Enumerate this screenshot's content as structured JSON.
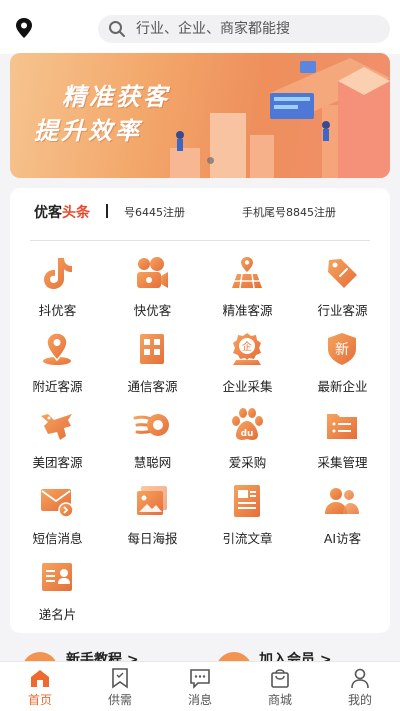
{
  "colors": {
    "accent": "#ee6a2f",
    "icon_gradient_start": "#f5a45e",
    "icon_gradient_end": "#e56e3a",
    "headline_highlight": "#e9492c"
  },
  "search": {
    "placeholder": "行业、企业、商家都能搜",
    "icon": "search-icon"
  },
  "location": {
    "icon": "location-pin-icon"
  },
  "banner": {
    "line1": "精准获客",
    "line2": "提升效率"
  },
  "ticker": {
    "brand_prefix": "优客",
    "brand_highlight": "头条",
    "items": [
      "号6445注册",
      "手机尾号8845注册"
    ]
  },
  "grid": [
    {
      "label": "抖优客",
      "icon": "tiktok-icon"
    },
    {
      "label": "快优客",
      "icon": "video-camera-icon"
    },
    {
      "label": "精准客源",
      "icon": "map-icon"
    },
    {
      "label": "行业客源",
      "icon": "tag-icon"
    },
    {
      "label": "附近客源",
      "icon": "location-icon"
    },
    {
      "label": "通信客源",
      "icon": "building-icon"
    },
    {
      "label": "企业采集",
      "icon": "enterprise-badge-icon"
    },
    {
      "label": "最新企业",
      "icon": "new-shield-icon"
    },
    {
      "label": "美团客源",
      "icon": "kangaroo-icon"
    },
    {
      "label": "慧聪网",
      "icon": "comet-icon"
    },
    {
      "label": "爱采购",
      "icon": "paw-du-icon"
    },
    {
      "label": "采集管理",
      "icon": "list-folder-icon"
    },
    {
      "label": "短信消息",
      "icon": "envelope-icon"
    },
    {
      "label": "每日海报",
      "icon": "image-icon"
    },
    {
      "label": "引流文章",
      "icon": "article-icon"
    },
    {
      "label": "AI访客",
      "icon": "users-icon"
    },
    {
      "label": "递名片",
      "icon": "business-card-icon"
    }
  ],
  "promo": {
    "left": "新手教程 >",
    "right": "加入会员 >"
  },
  "tabs": [
    {
      "label": "首页",
      "icon": "home-icon",
      "active": true
    },
    {
      "label": "供需",
      "icon": "bookmark-icon",
      "active": false
    },
    {
      "label": "消息",
      "icon": "chat-icon",
      "active": false
    },
    {
      "label": "商城",
      "icon": "shop-bag-icon",
      "active": false
    },
    {
      "label": "我的",
      "icon": "person-icon",
      "active": false
    }
  ]
}
